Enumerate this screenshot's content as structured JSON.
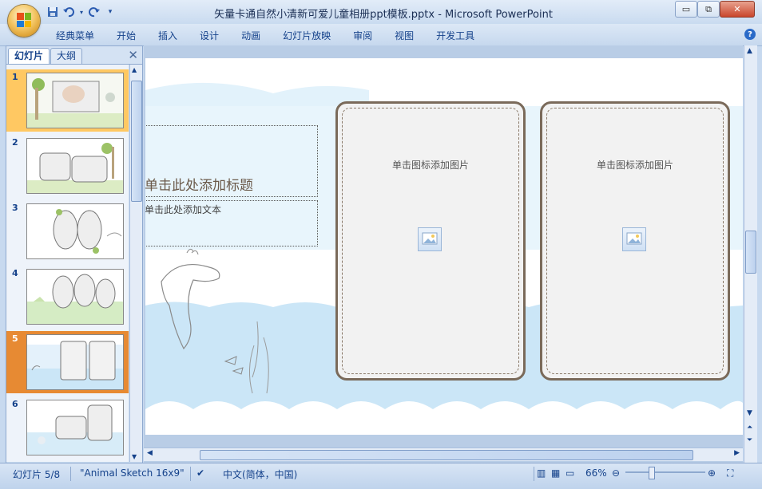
{
  "window": {
    "title": "矢量卡通自然小清新可爱儿童相册ppt模板.pptx - Microsoft PowerPoint",
    "controls": {
      "minimize": "▭",
      "maximize": "⧉",
      "close": "✕"
    }
  },
  "menubar": {
    "items": [
      "经典菜单",
      "开始",
      "插入",
      "设计",
      "动画",
      "幻灯片放映",
      "审阅",
      "视图",
      "开发工具"
    ],
    "help": "?"
  },
  "left_pane": {
    "tabs": [
      "幻灯片",
      "大纲"
    ],
    "close_glyph": "✕",
    "thumbnails": [
      {
        "num": "1"
      },
      {
        "num": "2"
      },
      {
        "num": "3"
      },
      {
        "num": "4"
      },
      {
        "num": "5"
      },
      {
        "num": "6"
      }
    ]
  },
  "slide": {
    "title_placeholder": "单击此处添加标题",
    "text_placeholder": "单击此处添加文本",
    "frame1_label": "单击图标添加图片",
    "frame2_label": "单击图标添加图片"
  },
  "statusbar": {
    "slide_position": "幻灯片 5/8",
    "theme": "\"Animal Sketch 16x9\"",
    "language": "中文(简体，中国)",
    "zoom": "66%"
  },
  "colors": {
    "accent": "#15428b",
    "selected_thumb": "#e78a33",
    "sky": "#dbeefa",
    "water": "#cbe6f7"
  }
}
